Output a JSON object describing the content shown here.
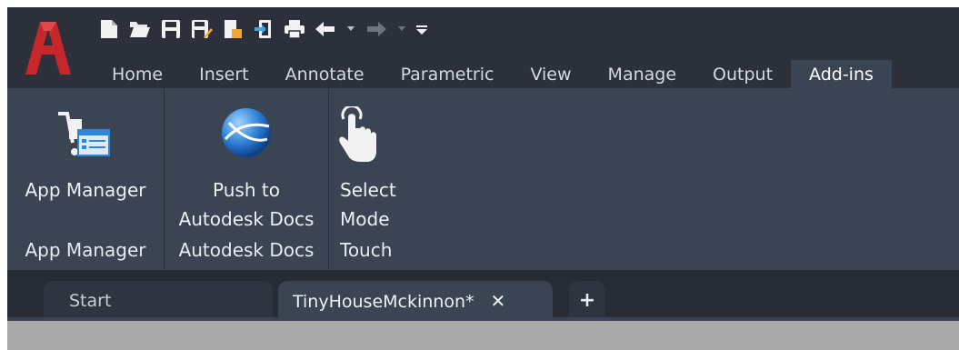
{
  "ribbon_tabs": [
    "Home",
    "Insert",
    "Annotate",
    "Parametric",
    "View",
    "Manage",
    "Output",
    "Add-ins"
  ],
  "active_tab": "Add-ins",
  "quick_access": [
    "new-icon",
    "open-icon",
    "save-icon",
    "save-as-icon",
    "share-icon",
    "import-icon",
    "print-icon",
    "undo-icon",
    "redo-icon",
    "customize-icon"
  ],
  "panels": {
    "app_manager": {
      "button_label": "App Manager",
      "title": "App Manager"
    },
    "autodesk_docs": {
      "button_line1": "Push to",
      "button_line2": "Autodesk Docs",
      "title": "Autodesk Docs"
    },
    "touch": {
      "button_line1": "Select",
      "button_line2": "Mode",
      "title": "Touch"
    }
  },
  "document_tabs": {
    "start": "Start",
    "current": "TinyHouseMckinnon*",
    "close_glyph": "✕",
    "add_glyph": "+"
  },
  "colors": {
    "accent_red": "#c7262b",
    "ribbon_bg": "#3b4453",
    "title_bg": "#2b303b"
  }
}
